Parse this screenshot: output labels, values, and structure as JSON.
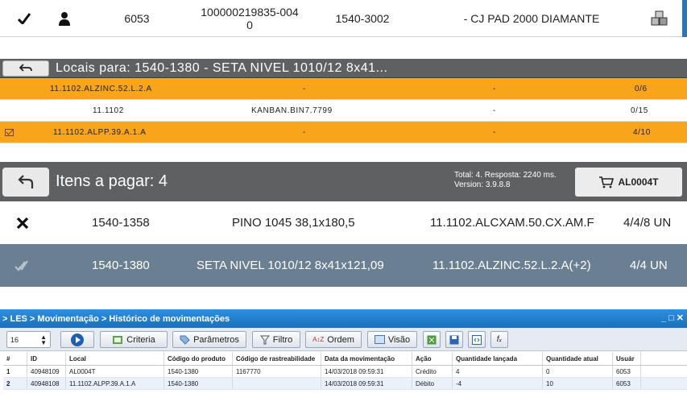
{
  "top_row": {
    "code": "6053",
    "order_number": "100000219835-004\n0",
    "part_number": "1540-3002",
    "description": "- CJ PAD 2000 DIAMANTE"
  },
  "locais": {
    "title": "Locais para: 1540-1380 - SETA NIVEL 1010/12 8x41...",
    "rows": [
      {
        "local": "11.1102.ALZINC.52.L.2.A",
        "kanban": "-",
        "col3": "-",
        "qty": "0/6",
        "style": "orange"
      },
      {
        "local": "11.1102",
        "kanban": "KANBAN.BIN7.7799",
        "col3": "-",
        "qty": "0/15",
        "style": "white"
      },
      {
        "local": "11.1102.ALPP.39.A.1.A",
        "kanban": "-",
        "col3": "-",
        "qty": "4/10",
        "style": "orange"
      }
    ]
  },
  "itens": {
    "title": "Itens a pagar: 4",
    "meta_line1": "Total: 4. Resposta: 2240 ms.",
    "meta_line2": "Version: 3.9.8.8",
    "cart_label": "AL0004T",
    "rows": [
      {
        "code": "1540-1358",
        "description": "PINO 1045 38,1x180,5",
        "local": "11.1102.ALCXAM.50.CX.AM.F",
        "qty": "4/4/8 UN"
      },
      {
        "code": "1540-1380",
        "description": "SETA NIVEL 1010/12 8x41x121,09",
        "local": "11.1102.ALZINC.52.L.2.A(+2)",
        "qty": "4/4 UN"
      }
    ]
  },
  "les": {
    "breadcrumb": "> LES > Movimentação > Histórico de movimentações",
    "page_size": "16",
    "toolbar": {
      "criteria": "Criteria",
      "parametros": "Parâmetros",
      "filtro": "Filtro",
      "ordem": "Ordem",
      "visao": "Visão"
    },
    "columns": [
      "#",
      "ID",
      "Local",
      "Código do produto",
      "Código de rastreabilidade",
      "Data da movimentação",
      "Ação",
      "Quantidade lançada",
      "Quantidade atual",
      "Usuár"
    ],
    "rows": [
      [
        "1",
        "40948109",
        "AL0004T",
        "1540-1380",
        "1167770",
        "14/03/2018 09:59:31",
        "Crédito",
        "4",
        "0",
        "6053"
      ],
      [
        "2",
        "40948108",
        "11.1102.ALPP.39.A.1.A",
        "1540-1380",
        "",
        "14/03/2018 09:59:31",
        "Débito",
        "-4",
        "10",
        "6053"
      ]
    ]
  },
  "colors": {
    "orange_row": "#f8a51b",
    "header_gray": "#5f6062",
    "selected_row": "#6b7f92",
    "window_blue": "#1f78c8"
  }
}
